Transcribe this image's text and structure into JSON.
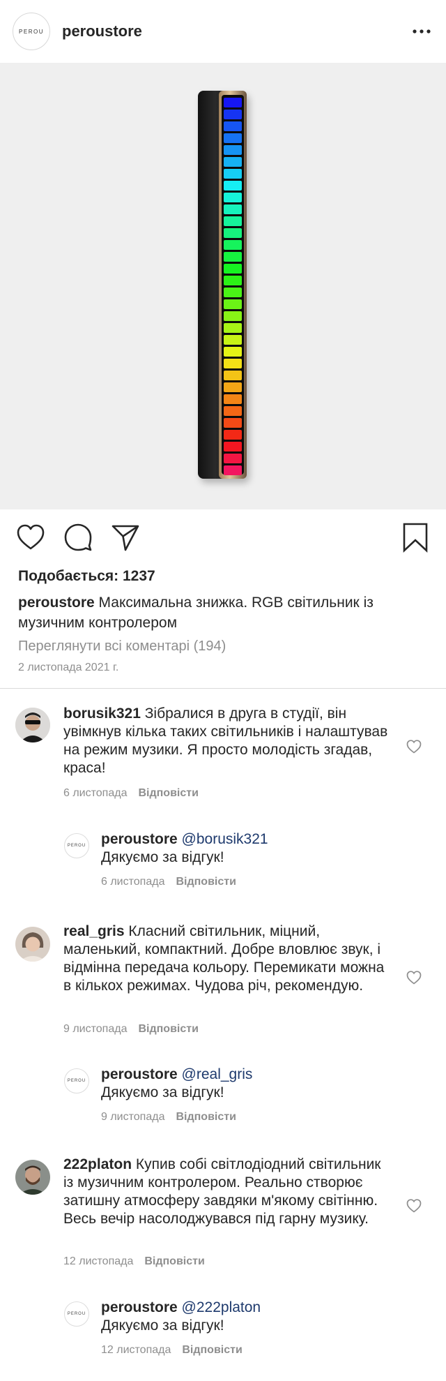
{
  "header": {
    "username": "peroustore",
    "logo_text": "PEROU",
    "more_icon": "more-horizontal-icon"
  },
  "post": {
    "likes_label": "Подобається: 1237",
    "caption_user": "peroustore",
    "caption_text": "Максимальна знижка. RGB світильник із музичним контролером",
    "view_comments": "Переглянути всі коментарі (194)",
    "date": "2 листопада 2021 г."
  },
  "reply_label": "Відповісти",
  "comments": [
    {
      "user": "borusik321",
      "text": "Зібралися в друга в студії, він увімкнув кілька таких світильників і налаштував на режим музики. Я просто молодість згадав, краса!",
      "date": "6 листопада"
    },
    {
      "user": "peroustore",
      "mention": "@borusik321",
      "text": "Дякуємо за відгук!",
      "date": "6 листопада"
    },
    {
      "user": "real_gris",
      "text": "Класний світильник, міцний, маленький, компактний. Добре вловлює звук, і відмінна передача кольору. Перемикати можна в кількох режимах. Чудова річ, рекомендую.",
      "date": "9 листопада"
    },
    {
      "user": "peroustore",
      "mention": "@real_gris",
      "text": "Дякуємо за відгук!",
      "date": "9 листопада"
    },
    {
      "user": "222platon",
      "text": "Купив собі світлодіодний світильник із музичним контролером. Реально створює затишну атмосферу завдяки м'якому світінню. Весь вечір насолоджувався під гарну музику.",
      "date": "12 листопада"
    },
    {
      "user": "peroustore",
      "mention": "@222platon",
      "text": "Дякуємо за відгук!",
      "date": "12 листопада"
    }
  ]
}
